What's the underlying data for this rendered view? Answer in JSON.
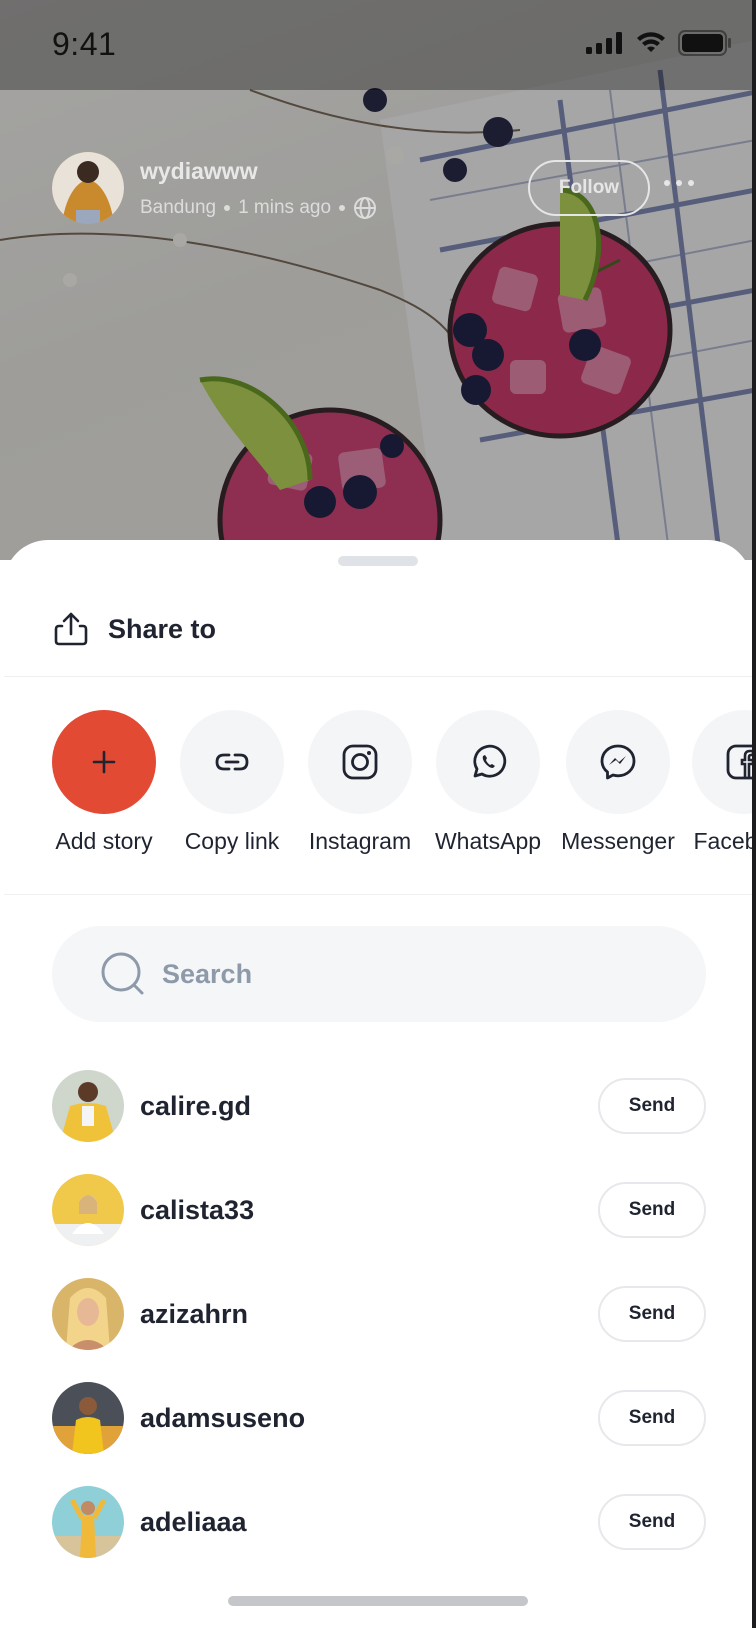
{
  "status_bar": {
    "time": "9:41"
  },
  "post": {
    "username": "wydiawww",
    "location": "Bandung",
    "time_ago": "1 mins ago",
    "follow_label": "Follow"
  },
  "sheet": {
    "title": "Share to",
    "apps": [
      {
        "label": "Add story",
        "icon": "plus-icon"
      },
      {
        "label": "Copy link",
        "icon": "link-icon"
      },
      {
        "label": "Instagram",
        "icon": "instagram-icon"
      },
      {
        "label": "WhatsApp",
        "icon": "whatsapp-icon"
      },
      {
        "label": "Messenger",
        "icon": "messenger-icon"
      },
      {
        "label": "Facebook",
        "icon": "facebook-icon"
      }
    ],
    "search_placeholder": "Search",
    "contacts": [
      {
        "name": "calire.gd",
        "action": "Send"
      },
      {
        "name": "calista33",
        "action": "Send"
      },
      {
        "name": "azizahrn",
        "action": "Send"
      },
      {
        "name": "adamsuseno",
        "action": "Send"
      },
      {
        "name": "adeliaaa",
        "action": "Send"
      }
    ]
  },
  "colors": {
    "accent": "#E24A34",
    "text": "#1F2430",
    "muted": "#8E9AAA",
    "surface": "#F4F6F8"
  }
}
